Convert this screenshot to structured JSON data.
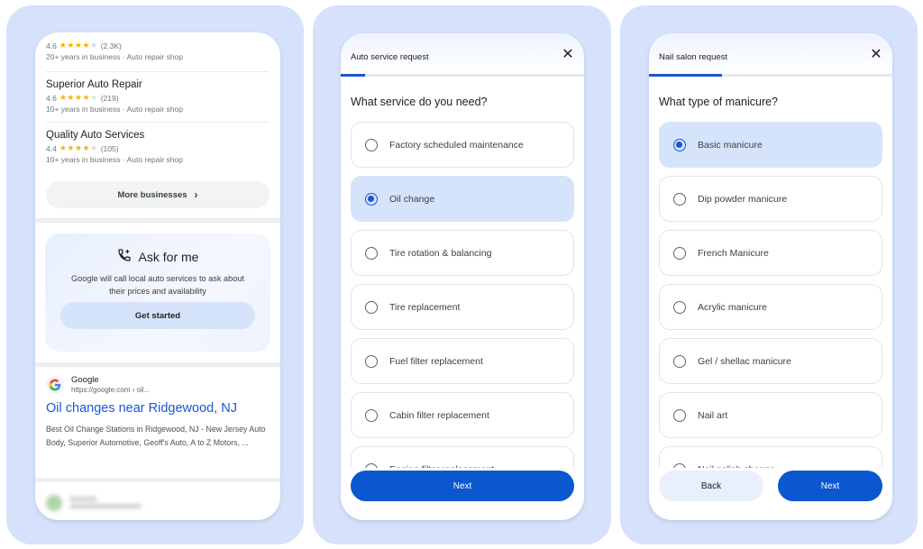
{
  "panel1": {
    "businesses": [
      {
        "name": "",
        "rating": "4.6",
        "stars_filled": 4,
        "review_count": "(2.3K)",
        "years": "20+ years in business",
        "category": "Auto repair shop"
      },
      {
        "name": "Superior Auto Repair",
        "rating": "4.6",
        "stars_filled": 4,
        "review_count": "(219)",
        "years": "10+ years in business",
        "category": "Auto repair shop"
      },
      {
        "name": "Quality Auto Services",
        "rating": "4.4",
        "stars_filled": 4,
        "review_count": "(105)",
        "years": "10+ years in business",
        "category": "Auto repair shop"
      }
    ],
    "meta_separator": "·",
    "more_businesses_label": "More businesses",
    "ask_card": {
      "title": "Ask for me",
      "description": "Google will call local auto services to ask about their prices and availability",
      "button_label": "Get started"
    },
    "result": {
      "source_name": "Google",
      "source_url": "https://google.com › oil...",
      "title": "Oil changes near Ridgewood, NJ",
      "snippet": "Best Oil Change Stations in Ridgewood, NJ - New Jersey Auto Body, Superior Automotive, Geoff's Auto, A to Z Motors, ..."
    }
  },
  "panel2": {
    "form_title": "Auto service request",
    "progress_percent": 10,
    "question": "What service do you need?",
    "options": [
      {
        "label": "Factory scheduled maintenance",
        "selected": false
      },
      {
        "label": "Oil change",
        "selected": true
      },
      {
        "label": "Tire rotation & balancing",
        "selected": false
      },
      {
        "label": "Tire replacement",
        "selected": false
      },
      {
        "label": "Fuel filter replacement",
        "selected": false
      },
      {
        "label": "Cabin filter replacement",
        "selected": false
      },
      {
        "label": "Engine filter replacement",
        "selected": false
      }
    ],
    "next_label": "Next"
  },
  "panel3": {
    "form_title": "Nail salon request",
    "progress_percent": 30,
    "question": "What type of manicure?",
    "options": [
      {
        "label": "Basic manicure",
        "selected": true
      },
      {
        "label": "Dip powder manicure",
        "selected": false
      },
      {
        "label": "French Manicure",
        "selected": false
      },
      {
        "label": "Acrylic manicure",
        "selected": false
      },
      {
        "label": "Gel / shellac manicure",
        "selected": false
      },
      {
        "label": "Nail art",
        "selected": false
      },
      {
        "label": "Nail polish change",
        "selected": false
      }
    ],
    "back_label": "Back",
    "next_label": "Next"
  },
  "colors": {
    "panel_bg": "#d6e2fb",
    "accent": "#0b57d0",
    "selected_option_bg": "#d6e4fb",
    "link": "#1a56d6",
    "star": "#f6b500"
  }
}
